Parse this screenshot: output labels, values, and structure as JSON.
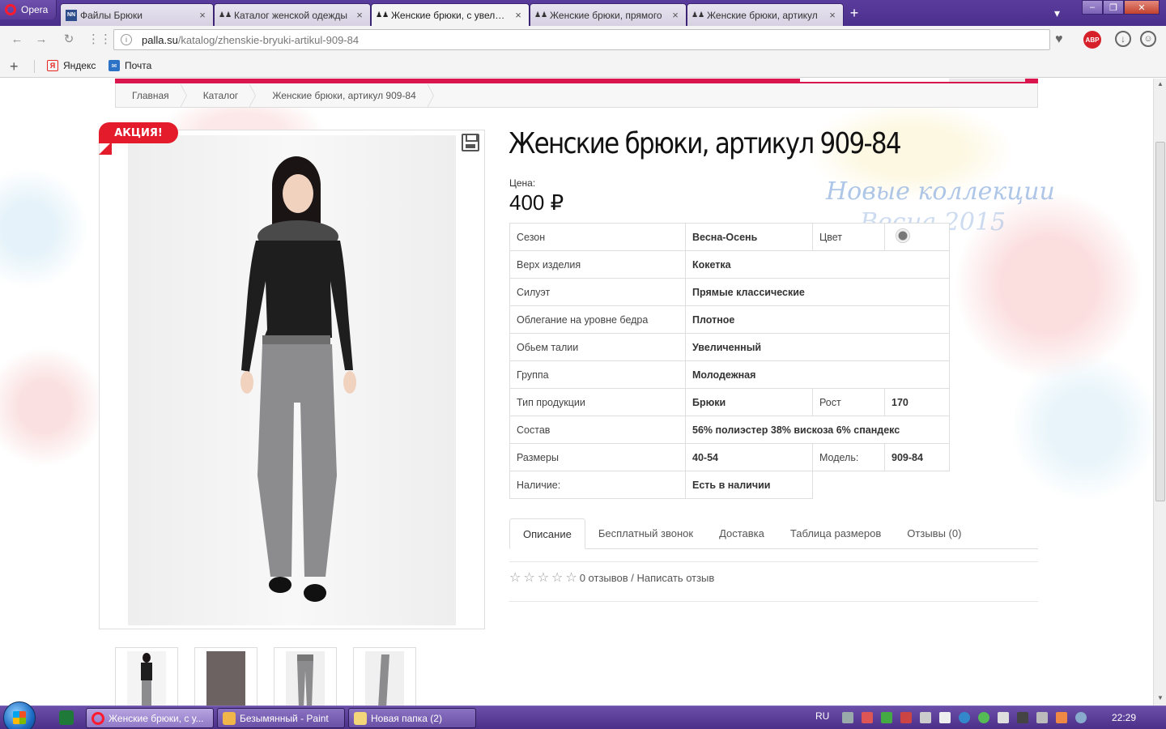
{
  "browser": {
    "menu_label": "Opera",
    "tabs": [
      {
        "title": "Файлы Брюки",
        "favicon": "NN"
      },
      {
        "title": "Каталог женской одежды",
        "favicon": "palla"
      },
      {
        "title": "Женские брюки, с увеличенным",
        "favicon": "palla"
      },
      {
        "title": "Женские брюки, прямого",
        "favicon": "palla"
      },
      {
        "title": "Женские брюки, артикул",
        "favicon": "palla"
      }
    ],
    "url_host": "palla.su",
    "url_path": "/katalog/zhenskie-bryuki-artikul-909-84",
    "abp_label": "ABP",
    "bookmarks": [
      {
        "label": "Яндекс",
        "icon": "yandex-icon",
        "glyph": "Я"
      },
      {
        "label": "Почта",
        "icon": "mail-icon",
        "glyph": "✉"
      }
    ]
  },
  "page": {
    "breadcrumbs": [
      "Главная",
      "Каталог",
      "Женские брюки, артикул 909-84"
    ],
    "sale_badge": "АКЦИЯ!",
    "title": "Женские брюки, артикул 909-84",
    "watermark_line1": "Новые коллекции",
    "watermark_line2": "Весна 2015",
    "price_label": "Цена:",
    "price": "400 ₽",
    "attributes": {
      "season_label": "Сезон",
      "season": "Весна-Осень",
      "color_label": "Цвет",
      "top_label": "Верх изделия",
      "top": "Кокетка",
      "silhouette_label": "Силуэт",
      "silhouette": "Прямые классические",
      "hip_label": "Облегание на уровне бедра",
      "hip": "Плотное",
      "waist_label": "Обьем талии",
      "waist": "Увеличенный",
      "group_label": "Группа",
      "group": "Молодежная",
      "type_label": "Тип продукции",
      "type": "Брюки",
      "height_label": "Рост",
      "height": "170",
      "composition_label": "Состав",
      "composition": "56% полиэстер 38% вискоза 6% спандекс",
      "sizes_label": "Размеры",
      "sizes": "40-54",
      "model_label": "Модель:",
      "model": "909-84",
      "availability_label": "Наличие:",
      "availability": "Есть в наличии"
    },
    "tabs": [
      "Описание",
      "Бесплатный звонок",
      "Доставка",
      "Таблица размеров",
      "Отзывы (0)"
    ],
    "reviews_text": "0 отзывов / Написать отзыв"
  },
  "taskbar": {
    "items": [
      "Женские брюки, с у...",
      "Безымянный - Paint",
      "Новая папка (2)"
    ],
    "lang": "RU",
    "time": "22:29"
  },
  "colors": {
    "brand_pink": "#d9164e",
    "sale_red": "#e31b2b",
    "opera_purple": "#4b2f8c"
  }
}
